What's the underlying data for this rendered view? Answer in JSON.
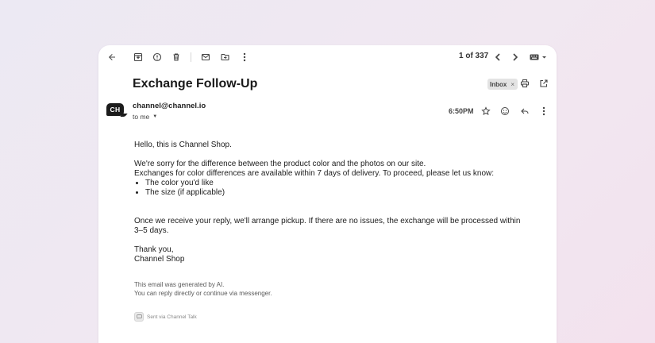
{
  "toolbar": {
    "icons": [
      "back-icon",
      "archive-icon",
      "report-spam-icon",
      "delete-icon",
      "mark-unread-icon",
      "move-to-icon",
      "more-vert-icon"
    ],
    "pager_text": "1 of 337",
    "nav_icons": [
      "chevron-left-icon",
      "chevron-right-icon"
    ],
    "input_tools_icon": "keyboard-icon"
  },
  "email": {
    "subject": "Exchange Follow-Up",
    "label": "Inbox",
    "label_remove": "×",
    "header_icons": [
      "print-icon",
      "open-in-new-window-icon"
    ],
    "sender": {
      "avatar_text": "CH",
      "address": "channel@channel.io",
      "recipient": "to me"
    },
    "time": "6:50PM",
    "action_icons": [
      "star-icon",
      "emoji-icon",
      "reply-icon",
      "more-vert-icon"
    ],
    "body": {
      "greeting": "Hello, this is Channel Shop.",
      "para1_line1": "We're sorry for the difference between the product color and the photos on our site.",
      "para1_line2": "Exchanges for color differences are available within 7 days of delivery. To proceed, please let us know:",
      "bullets": [
        "The color you'd like",
        "The size (if applicable)"
      ],
      "para2": "Once we receive your reply, we'll arrange pickup. If there are no issues, the exchange will be processed within 3–5 days.",
      "closing": "Thank you,",
      "signature": "Channel Shop"
    },
    "footnote_line1": "This email was generated by AI.",
    "footnote_line2": "You can reply directly or continue via messenger.",
    "sent_via": "Sent via Channel Talk"
  }
}
